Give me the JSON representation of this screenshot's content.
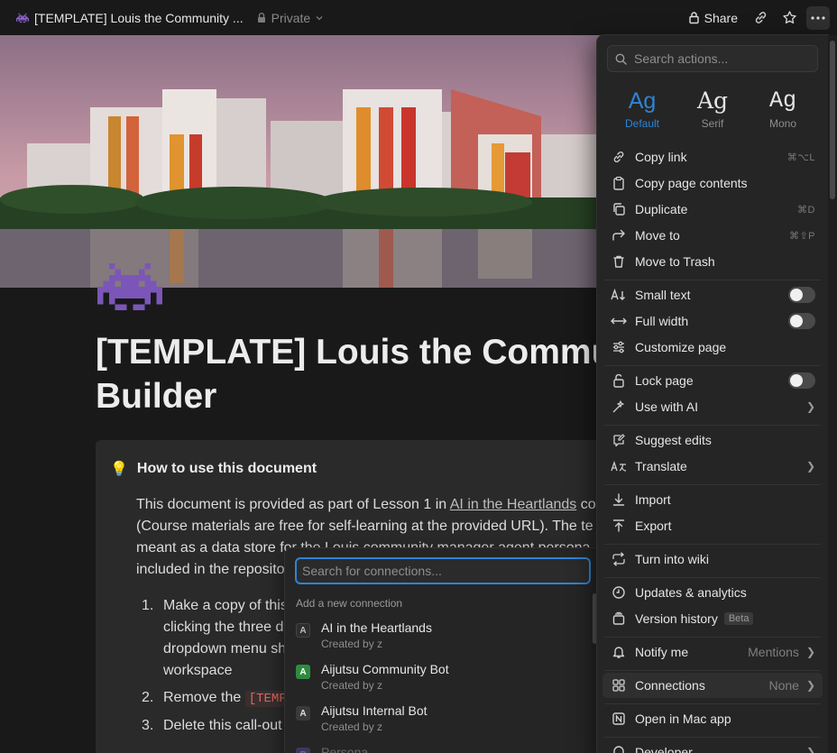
{
  "topbar": {
    "title": "[TEMPLATE] Louis the Community ...",
    "privacy": "Private",
    "share_label": "Share"
  },
  "page": {
    "title_line1": "[TEMPLATE] Louis the Commu",
    "title_line2": "Builder"
  },
  "callout": {
    "emoji": "💡",
    "heading": "How to use this document",
    "p_line1_pre": "This document is provided as part of Lesson 1 in ",
    "p_line1_link": "AI in the Heartlands",
    "p_line1_post": " co",
    "p_line2": "(Course materials are free for self-learning at the provided URL). The te",
    "p_line3": "meant as a data store for the Louis community manager agent persona",
    "p_line4": "included in the reposito",
    "steps": [
      {
        "num": "1.",
        "lines": [
          "Make a copy of this",
          "clicking the three d",
          "dropdown menu sh",
          "workspace"
        ]
      },
      {
        "num": "2.",
        "pre": "Remove the ",
        "code": "[TEMP"
      },
      {
        "num": "3.",
        "text": "Delete this call-out"
      }
    ]
  },
  "connections_popup": {
    "placeholder": "Search for connections...",
    "section": "Add a new connection",
    "items": [
      {
        "name": "AI in the Heartlands",
        "sub": "Created by z",
        "badge": "A"
      },
      {
        "name": "Aijutsu Community Bot",
        "sub": "Created by z",
        "badge": "A"
      },
      {
        "name": "Aijutsu Internal Bot",
        "sub": "Created by z",
        "badge": "A"
      },
      {
        "name": "Persona",
        "sub": "",
        "badge": "P"
      }
    ]
  },
  "menu": {
    "search_placeholder": "Search actions...",
    "fonts": [
      {
        "ag": "Ag",
        "label": "Default"
      },
      {
        "ag": "Ag",
        "label": "Serif"
      },
      {
        "ag": "Ag",
        "label": "Mono"
      }
    ],
    "copy_link": "Copy link",
    "copy_link_sc": "⌘⌥L",
    "copy_contents": "Copy page contents",
    "duplicate": "Duplicate",
    "duplicate_sc": "⌘D",
    "move_to": "Move to",
    "move_to_sc": "⌘⇧P",
    "trash": "Move to Trash",
    "small_text": "Small text",
    "full_width": "Full width",
    "customize": "Customize page",
    "lock": "Lock page",
    "use_ai": "Use with AI",
    "suggest": "Suggest edits",
    "translate": "Translate",
    "import": "Import",
    "export": "Export",
    "wiki": "Turn into wiki",
    "updates": "Updates & analytics",
    "version": "Version history",
    "beta": "Beta",
    "notify": "Notify me",
    "notify_val": "Mentions",
    "connections": "Connections",
    "connections_val": "None",
    "mac": "Open in Mac app",
    "developer": "Developer"
  }
}
